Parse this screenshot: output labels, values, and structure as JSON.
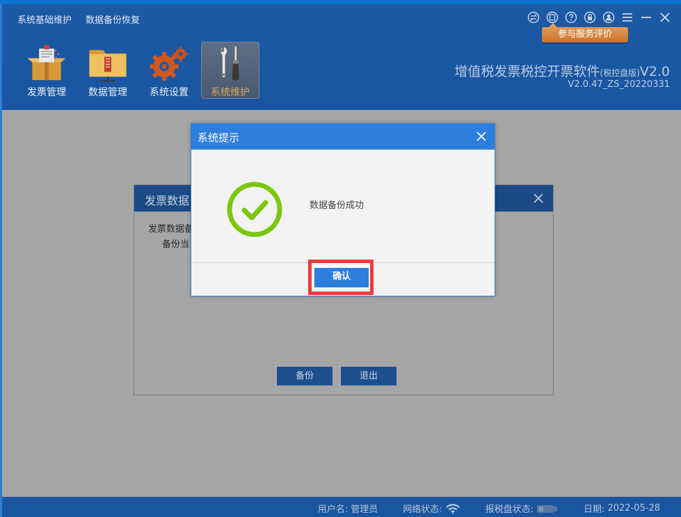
{
  "menu": [
    {
      "label": "系统基础维护"
    },
    {
      "label": "数据备份恢复"
    }
  ],
  "window_icons": [
    "exchange-icon",
    "feedback-icon",
    "help-icon",
    "lock-icon",
    "user-icon",
    "menu-icon",
    "minimize-icon",
    "close-icon"
  ],
  "service_eval_button": "参与服务评价",
  "toolbar": [
    {
      "label": "发票管理",
      "icon": "invoice-box-icon",
      "active": false
    },
    {
      "label": "数据管理",
      "icon": "data-folder-icon",
      "active": false
    },
    {
      "label": "系统设置",
      "icon": "gears-icon",
      "active": false
    },
    {
      "label": "系统维护",
      "icon": "wrench-screwdriver-icon",
      "active": true
    }
  ],
  "app": {
    "title_main": "增值税发票税控开票软件",
    "title_edition": "(税控盘版)",
    "title_version": "V2.0",
    "build": "V2.0.47_ZS_20220331"
  },
  "background_dialog": {
    "title": "发票数据",
    "line1": "发票数据备",
    "line2": "备份当",
    "backup_button": "备份",
    "exit_button": "退出"
  },
  "dialog": {
    "title": "系统提示",
    "message": "数据备份成功",
    "confirm_button": "确认"
  },
  "status": {
    "user_label": "用户名:",
    "user_value": "管理员",
    "network_label": "网络状态:",
    "disk_label": "报税盘状态:",
    "date_label": "日期:",
    "date_value": "2022-05-28"
  },
  "colors": {
    "header_bg": "#1c5aa6",
    "dialog_header": "#2e7ede",
    "success_green": "#7ac70c",
    "highlight_red": "#ea3c3c",
    "eval_orange": "#d8843f"
  }
}
